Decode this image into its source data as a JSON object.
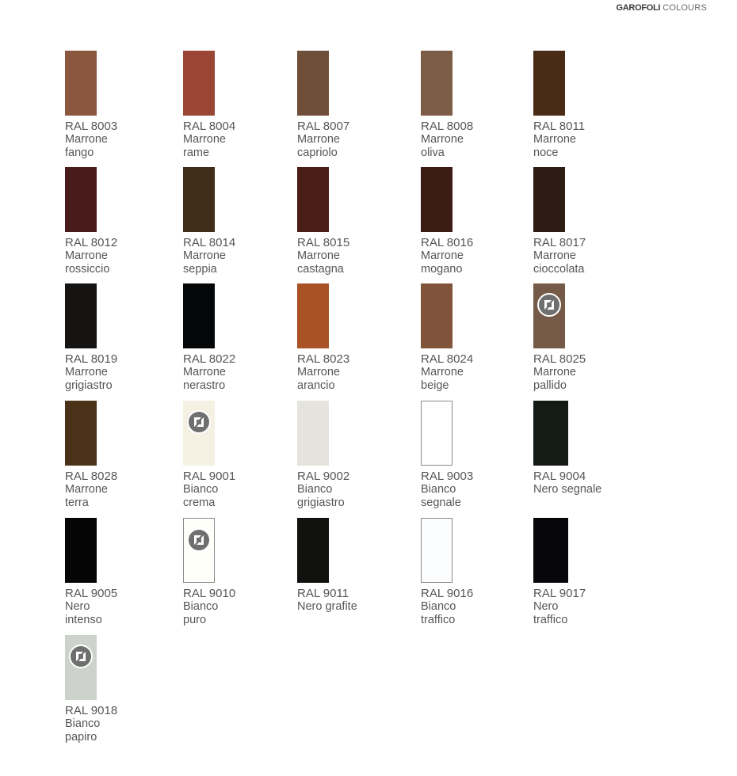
{
  "header": {
    "brand": "GAROFOLI",
    "subtitle": "COLOURS"
  },
  "badge_icon": "certified-finish-icon",
  "swatches": [
    {
      "code": "RAL 8003",
      "name": "Marrone\nfango",
      "color": "#8b583f"
    },
    {
      "code": "RAL 8004",
      "name": "Marrone\nrame",
      "color": "#9a4535"
    },
    {
      "code": "RAL 8007",
      "name": "Marrone\ncapriolo",
      "color": "#704f3a"
    },
    {
      "code": "RAL 8008",
      "name": "Marrone\noliva",
      "color": "#7e5d48"
    },
    {
      "code": "RAL 8011",
      "name": "Marrone\nnoce",
      "color": "#4a2b16"
    },
    {
      "code": "RAL 8012",
      "name": "Marrone\nrossiccio",
      "color": "#4a1b1b"
    },
    {
      "code": "RAL 8014",
      "name": "Marrone\nseppia",
      "color": "#3f2c19"
    },
    {
      "code": "RAL 8015",
      "name": "Marrone\ncastagna",
      "color": "#4b1d17"
    },
    {
      "code": "RAL 8016",
      "name": "Marrone\nmogano",
      "color": "#3b1c15"
    },
    {
      "code": "RAL 8017",
      "name": "Marrone\ncioccolata",
      "color": "#2d1c14"
    },
    {
      "code": "RAL 8019",
      "name": "Marrone\ngrigiastro",
      "color": "#161412"
    },
    {
      "code": "RAL 8022",
      "name": "Marrone\nnerastro",
      "color": "#050608"
    },
    {
      "code": "RAL 8023",
      "name": "Marrone\narancio",
      "color": "#a85226"
    },
    {
      "code": "RAL 8024",
      "name": "Marrone\nbeige",
      "color": "#80533a"
    },
    {
      "code": "RAL 8025",
      "name": "Marrone\npallido",
      "color": "#765a48",
      "badge": true
    },
    {
      "code": "RAL 8028",
      "name": "Marrone\nterra",
      "color": "#4a3218"
    },
    {
      "code": "RAL 9001",
      "name": "Bianco\ncrema",
      "color": "#f4f1e3",
      "badge": true
    },
    {
      "code": "RAL 9002",
      "name": "Bianco\ngrigiastro",
      "color": "#e4e4dc"
    },
    {
      "code": "RAL 9003",
      "name": "Bianco\nsegnale",
      "color": "#ffffff",
      "outlined": true
    },
    {
      "code": "RAL 9004",
      "name": "Nero segnale",
      "color": "#141a16"
    },
    {
      "code": "RAL 9005",
      "name": "Nero\nintenso",
      "color": "#050505"
    },
    {
      "code": "RAL 9010",
      "name": "Bianco\npuro",
      "color": "#fffffa",
      "outlined": true,
      "badge": true
    },
    {
      "code": "RAL 9011",
      "name": "Nero grafite",
      "color": "#111110"
    },
    {
      "code": "RAL 9016",
      "name": "Bianco\ntraffico",
      "color": "#fcfdff",
      "outlined": true
    },
    {
      "code": "RAL 9017",
      "name": "Nero\ntraffico",
      "color": "#07070a"
    },
    {
      "code": "RAL 9018",
      "name": "Bianco\npapiro",
      "color": "#cdd2cc",
      "badge": true
    }
  ]
}
